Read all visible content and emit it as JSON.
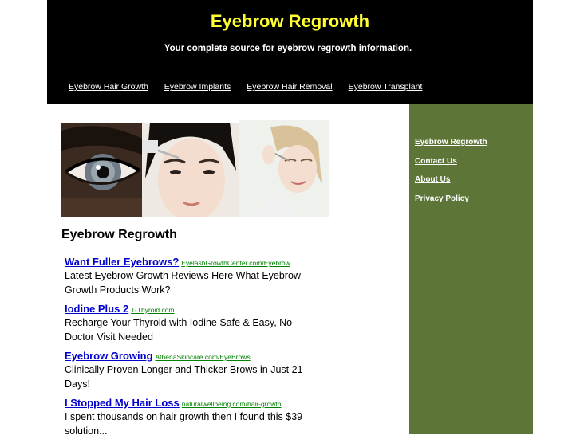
{
  "header": {
    "title": "Eyebrow Regrowth",
    "tagline": "Your complete source for eyebrow regrowth information."
  },
  "topnav": [
    {
      "label": "Eyebrow Hair Growth"
    },
    {
      "label": "Eyebrow Implants"
    },
    {
      "label": "Eyebrow Hair Removal"
    },
    {
      "label": "Eyebrow Transplant"
    }
  ],
  "sidebar": {
    "links": [
      {
        "label": "Eyebrow Regrowth"
      },
      {
        "label": "Contact Us"
      },
      {
        "label": "About Us"
      },
      {
        "label": "Privacy Policy"
      }
    ]
  },
  "main": {
    "heading": "Eyebrow Regrowth",
    "ads": [
      {
        "title": "Want Fuller Eyebrows?",
        "url": "EyelashGrowthCenter.com/Eyebrow",
        "desc": "Latest Eyebrow Growth Reviews Here What Eyebrow Growth Products Work?"
      },
      {
        "title": "Iodine Plus 2",
        "url": "1-Thyroid.com",
        "desc": "Recharge Your Thyroid with Iodine Safe & Easy, No Doctor Visit Needed"
      },
      {
        "title": "Eyebrow Growing",
        "url": "AthenaSkincare.com/EyeBrows",
        "desc": "Clinically Proven Longer and Thicker Brows in Just 21 Days!"
      },
      {
        "title": "I Stopped My Hair Loss",
        "url": "naturalwellbeing.com/hair-growth",
        "desc": "I spent thousands on hair growth then I found this $39 solution..."
      }
    ]
  },
  "colors": {
    "header_bg": "#000000",
    "title": "#ffff33",
    "sidebar_bg": "#5e7538",
    "ad_title": "#0000cc",
    "ad_url": "#008000"
  }
}
